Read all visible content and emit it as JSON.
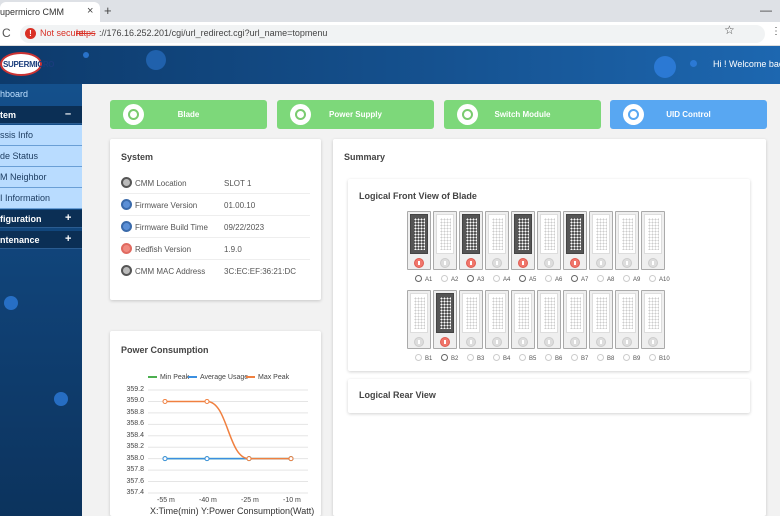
{
  "browser": {
    "tab_title": "upermicro CMM",
    "tab_close": "×",
    "new_tab": "+",
    "window_minimize": "—",
    "reload_icon": "C",
    "security_label": "Not secure",
    "url_scheme": "https",
    "url_rest": "://176.16.252.201/cgi/url_redirect.cgi?url_name=topmenu",
    "bookmark_icon": "☆",
    "more_icon": "⋮"
  },
  "header": {
    "logo_text": "SUPERMICRO",
    "welcome": "Hi ! Welcome back !"
  },
  "sidebar": {
    "dashboard": "hboard",
    "system_group": {
      "label": "tem",
      "toggle": "–"
    },
    "items": [
      {
        "label": "ssis Info"
      },
      {
        "label": "de Status"
      },
      {
        "label": "M Neighbor"
      },
      {
        "label": "I Information"
      }
    ],
    "configuration_group": {
      "label": "figuration",
      "toggle": "+"
    },
    "maintenance_group": {
      "label": "ntenance",
      "toggle": "+"
    }
  },
  "quick_buttons": [
    {
      "label": "Blade",
      "color": "#7dd87a"
    },
    {
      "label": "Power Supply",
      "color": "#7dd87a"
    },
    {
      "label": "Switch Module",
      "color": "#7dd87a"
    },
    {
      "label": "UID Control",
      "color": "#58a7f2"
    }
  ],
  "system_card": {
    "title": "System",
    "rows": [
      {
        "key": "CMM Location",
        "value": "SLOT 1"
      },
      {
        "key": "Firmware Version",
        "value": "01.00.10"
      },
      {
        "key": "Firmware Build Time",
        "value": "09/22/2023"
      },
      {
        "key": "Redfish Version",
        "value": "1.9.0"
      },
      {
        "key": "CMM MAC Address",
        "value": "3C:EC:EF:36:21:DC"
      }
    ]
  },
  "summary": {
    "title": "Summary",
    "front_view_title": "Logical Front View of Blade",
    "rear_view_title": "Logical Rear View",
    "row_a": [
      {
        "label": "A1",
        "on": true
      },
      {
        "label": "A2",
        "on": false
      },
      {
        "label": "A3",
        "on": true
      },
      {
        "label": "A4",
        "on": false
      },
      {
        "label": "A5",
        "on": true
      },
      {
        "label": "A6",
        "on": false
      },
      {
        "label": "A7",
        "on": true
      },
      {
        "label": "A8",
        "on": false
      },
      {
        "label": "A9",
        "on": false
      },
      {
        "label": "A10",
        "on": false
      }
    ],
    "row_b": [
      {
        "label": "B1",
        "on": false
      },
      {
        "label": "B2",
        "on": true
      },
      {
        "label": "B3",
        "on": false
      },
      {
        "label": "B4",
        "on": false
      },
      {
        "label": "B5",
        "on": false
      },
      {
        "label": "B6",
        "on": false
      },
      {
        "label": "B7",
        "on": false
      },
      {
        "label": "B8",
        "on": false
      },
      {
        "label": "B9",
        "on": false
      },
      {
        "label": "B10",
        "on": false
      }
    ]
  },
  "power_card": {
    "title": "Power Consumption"
  },
  "chart_data": {
    "type": "line",
    "title": "",
    "x": [
      "-55 m",
      "-40 m",
      "-25 m",
      "-10 m"
    ],
    "xlabel": "X:Time(min) Y:Power Consumption(Watt)",
    "ylabel": "",
    "ylim": [
      357.4,
      359.2
    ],
    "yticks": [
      "359.2",
      "359.0",
      "358.8",
      "358.6",
      "358.4",
      "358.2",
      "358.0",
      "357.8",
      "357.6",
      "357.4"
    ],
    "grid": true,
    "legend_position": "top",
    "series": [
      {
        "name": "Min Peak",
        "color": "#4caf50",
        "values": [
          358.0,
          358.0,
          358.0,
          358.0
        ]
      },
      {
        "name": "Average Usage",
        "color": "#3b8fe0",
        "values": [
          358.0,
          358.0,
          358.0,
          358.0
        ]
      },
      {
        "name": "Max Peak",
        "color": "#f08040",
        "values": [
          359.0,
          359.0,
          358.0,
          358.0
        ]
      }
    ]
  }
}
